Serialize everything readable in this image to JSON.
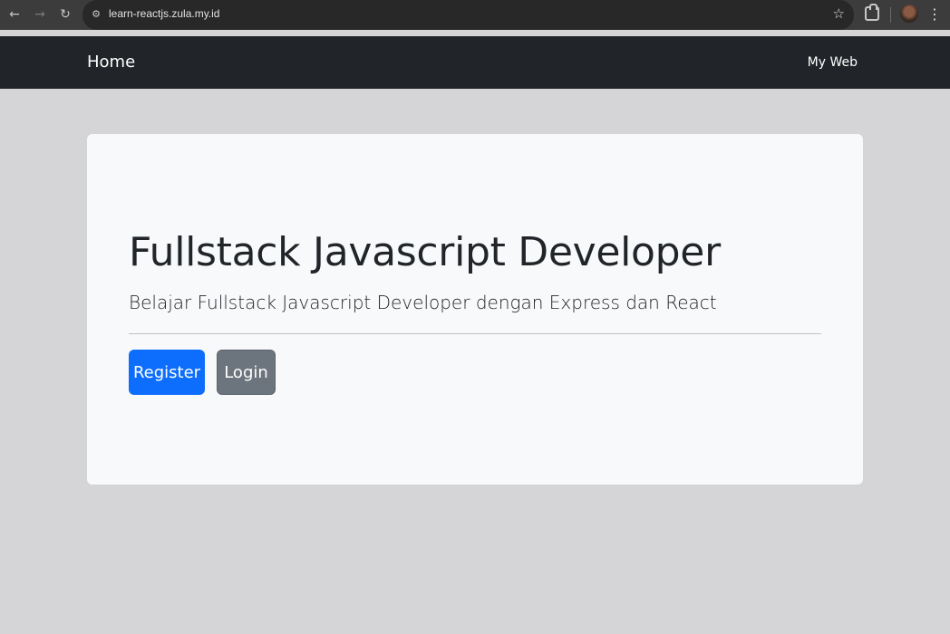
{
  "browser": {
    "url": "learn-reactjs.zula.my.id",
    "back_icon": "arrow-left-icon",
    "forward_icon": "arrow-right-icon",
    "reload_icon": "reload-icon",
    "bookmark_icon": "star-icon",
    "extensions_icon": "puzzle-icon",
    "menu_icon": "kebab-menu-icon"
  },
  "navbar": {
    "brand": "Home",
    "link": "My Web",
    "background": "#212529"
  },
  "hero": {
    "title": "Fullstack Javascript Developer",
    "subtitle": "Belajar Fullstack Javascript Developer dengan Express dan React",
    "register_label": "Register",
    "login_label": "Login",
    "primary_color": "#0d6efd",
    "secondary_color": "#6c757d"
  }
}
